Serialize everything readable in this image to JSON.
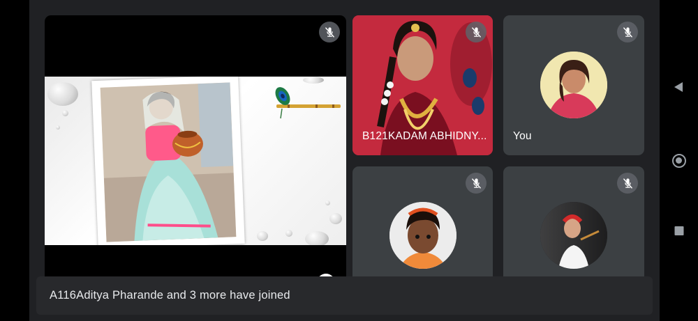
{
  "participants": {
    "main": {
      "muted": true
    },
    "tile_b121": {
      "name": "B121KADAM ABHIDNY...",
      "muted": true
    },
    "tile_you": {
      "name": "You",
      "muted": true
    },
    "tile_a": {
      "muted": true
    },
    "tile_b": {
      "muted": true
    }
  },
  "notification": {
    "text": "A116Aditya Pharande and 3 more have joined"
  },
  "icons": {
    "mute": "mic-off-icon",
    "nav_back": "back-triangle-icon",
    "nav_home": "home-circle-icon",
    "nav_recent": "recents-square-icon"
  },
  "colors": {
    "background": "#202124",
    "tile": "#3c4043",
    "toast": "#28292c",
    "text": "#ffffff"
  }
}
